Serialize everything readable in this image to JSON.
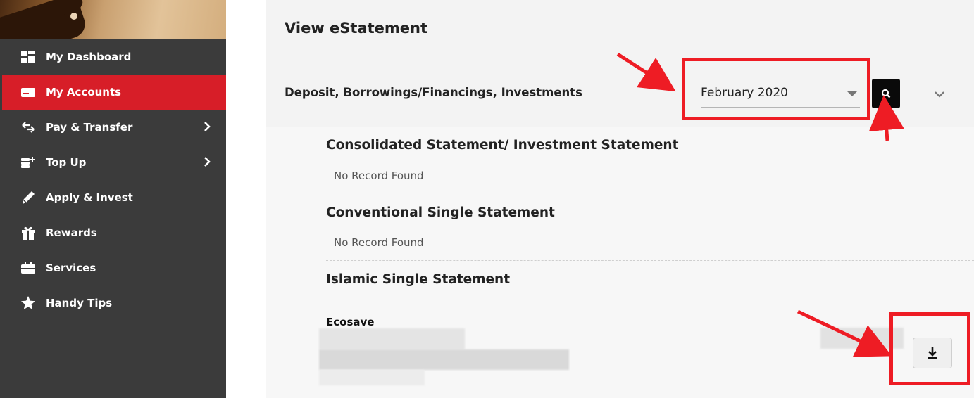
{
  "sidebar": {
    "items": [
      {
        "label": "My Dashboard",
        "icon": "dashboard-icon",
        "active": false,
        "has_submenu": false
      },
      {
        "label": "My Accounts",
        "icon": "accounts-icon",
        "active": true,
        "has_submenu": false
      },
      {
        "label": "Pay & Transfer",
        "icon": "transfer-icon",
        "active": false,
        "has_submenu": true
      },
      {
        "label": "Top Up",
        "icon": "top-up-icon",
        "active": false,
        "has_submenu": true
      },
      {
        "label": "Apply & Invest",
        "icon": "pen-icon",
        "active": false,
        "has_submenu": false
      },
      {
        "label": "Rewards",
        "icon": "gift-icon",
        "active": false,
        "has_submenu": false
      },
      {
        "label": "Services",
        "icon": "briefcase-icon",
        "active": false,
        "has_submenu": false
      },
      {
        "label": "Handy Tips",
        "icon": "star-icon",
        "active": false,
        "has_submenu": false
      }
    ],
    "active_color": "#d71e28",
    "background_color": "#3b3b3b"
  },
  "main": {
    "title": "View eStatement",
    "filter": {
      "label": "Deposit, Borrowings/Financings, Investments",
      "selected_month": "February 2020"
    },
    "sections": [
      {
        "title": "Consolidated Statement/ Investment Statement",
        "status": "No Record Found"
      },
      {
        "title": "Conventional Single Statement",
        "status": "No Record Found"
      },
      {
        "title": "Islamic Single Statement",
        "account": "Ecosave"
      }
    ]
  },
  "annotation_color": "#ee1c24"
}
